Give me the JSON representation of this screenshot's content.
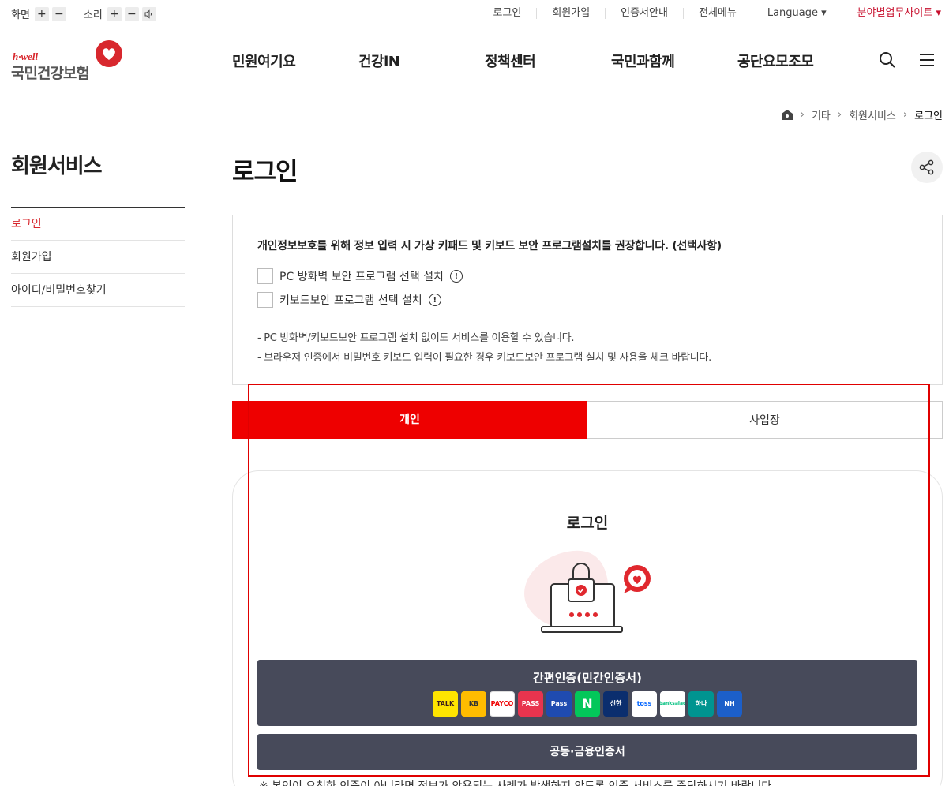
{
  "utility": {
    "screen_label": "화면",
    "sound_label": "소리",
    "plus": "+",
    "minus": "−",
    "links": [
      "로그인",
      "회원가입",
      "인증서안내",
      "전체메뉴",
      "Language ▾",
      "분야별업무사이트 ▾"
    ]
  },
  "logo": {
    "brand": "h·well",
    "name": "국민건강보험"
  },
  "gnb": {
    "menus": [
      "민원여기요",
      "건강iN",
      "정책센터",
      "국민과함께",
      "공단요모조모"
    ]
  },
  "breadcrumb": [
    "기타",
    "회원서비스",
    "로그인"
  ],
  "lnb": {
    "title": "회원서비스",
    "items": [
      "로그인",
      "회원가입",
      "아이디/비밀번호찾기"
    ]
  },
  "page": {
    "title": "로그인"
  },
  "notice": {
    "heading": "개인정보보호를 위해 정보 입력 시 가상 키패드 및 키보드 보안 프로그램설치를 권장합니다. (선택사항)",
    "options": [
      "PC 방화벽 보안 프로그램 선택 설치",
      "키보드보안 프로그램 선택 설치"
    ],
    "info_glyph": "!",
    "bullets": [
      "- PC 방화벽/키보드보안 프로그램 설치 없이도 서비스를 이용할 수 있습니다.",
      "- 브라우저 인증에서 비밀번호 키보드 입력이 필요한 경우 키보드보안 프로그램 설치 및 사용을 체크 바랍니다."
    ]
  },
  "tabs": [
    "개인",
    "사업장"
  ],
  "login": {
    "title": "로그인",
    "simple_cert_label": "간편인증(민간인증서)",
    "providers": [
      "TALK",
      "KB",
      "PAYCO",
      "PASS",
      "Pass",
      "N",
      "신한",
      "toss",
      "banksalad",
      "하나",
      "NH"
    ],
    "joint_cert_label": "공동·금융인증서",
    "footnote": "※ 본인이 요청한 인증이 아니라면 정보가 악용되는 사례가 발생하지 않도록 인증 서비스를 중단하시기 바랍니다."
  },
  "colors": {
    "accent": "#ee0000",
    "brand_red": "#d8282e",
    "button_dark": "#474a5a"
  }
}
